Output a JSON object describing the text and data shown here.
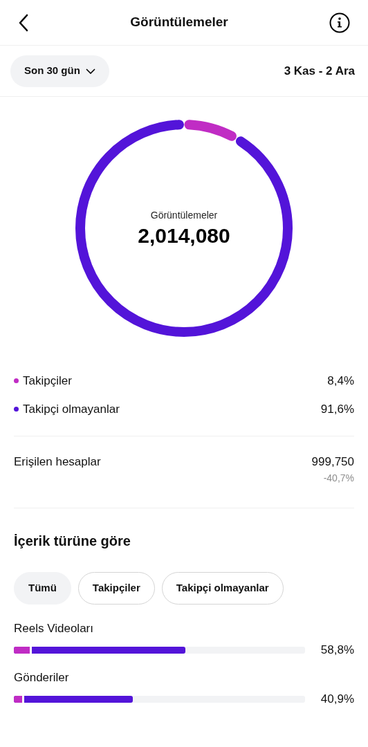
{
  "header": {
    "title": "Görüntülemeler"
  },
  "period": {
    "label": "Son 30 gün",
    "range": "3 Kas - 2 Ara"
  },
  "summary": {
    "label": "Görüntülemeler",
    "value": "2,014,080"
  },
  "legend": [
    {
      "label": "Takipçiler",
      "value": "8,4%",
      "color": "#c02cc4"
    },
    {
      "label": "Takipçi olmayanlar",
      "value": "91,6%",
      "color": "#5314d9"
    }
  ],
  "reach": {
    "label": "Erişilen hesaplar",
    "value": "999,750",
    "change": "-40,7%"
  },
  "content_type": {
    "title": "İçerik türüne göre",
    "filters": [
      {
        "label": "Tümü",
        "selected": true
      },
      {
        "label": "Takipçiler",
        "selected": false
      },
      {
        "label": "Takipçi olmayanlar",
        "selected": false
      }
    ],
    "rows": [
      {
        "label": "Reels Videoları",
        "value": "58,8%",
        "segments": [
          {
            "color": "#c02cc4",
            "level": 0.055
          },
          {
            "color": "#5314d9",
            "level": 0.588
          }
        ]
      },
      {
        "label": "Gönderiler",
        "value": "40,9%",
        "segments": [
          {
            "color": "#c02cc4",
            "level": 0.028
          },
          {
            "color": "#5314d9",
            "level": 0.409
          }
        ]
      }
    ]
  }
}
